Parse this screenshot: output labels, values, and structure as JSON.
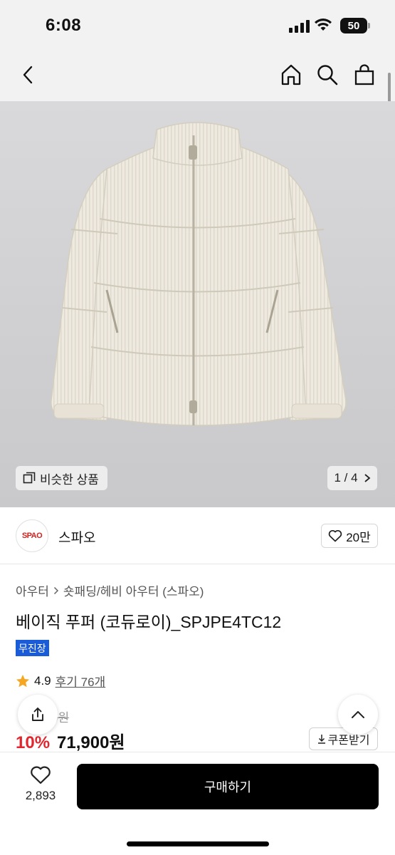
{
  "status": {
    "time": "6:08",
    "battery": "50"
  },
  "nav": {
    "back": "back-icon",
    "home": "home-icon",
    "search": "search-icon",
    "bag": "shopping-bag-icon"
  },
  "hero": {
    "similar_label": "비슷한 상품",
    "pager": "1 / 4"
  },
  "brand": {
    "logo_text": "SPAO",
    "name": "스파오",
    "likes": "20만",
    "accent": "#d1221f"
  },
  "breadcrumb": {
    "level1": "아우터",
    "level2": "숏패딩/헤비 아우터 (스파오)"
  },
  "product": {
    "title": "베이직 푸퍼 (코듀로이)_SPJPE4TC12",
    "tag": "무진장",
    "rating": "4.9",
    "review_label": "후기 76개",
    "original_price": "0원",
    "discount": "10%",
    "sale_price": "71,900원",
    "coupon_label": "쿠폰받기"
  },
  "bottom": {
    "wish_count": "2,893",
    "buy_label": "구매하기"
  },
  "colors": {
    "discount": "#e0262e",
    "tag_bg": "#1a5bd8",
    "star": "#f5a623"
  }
}
